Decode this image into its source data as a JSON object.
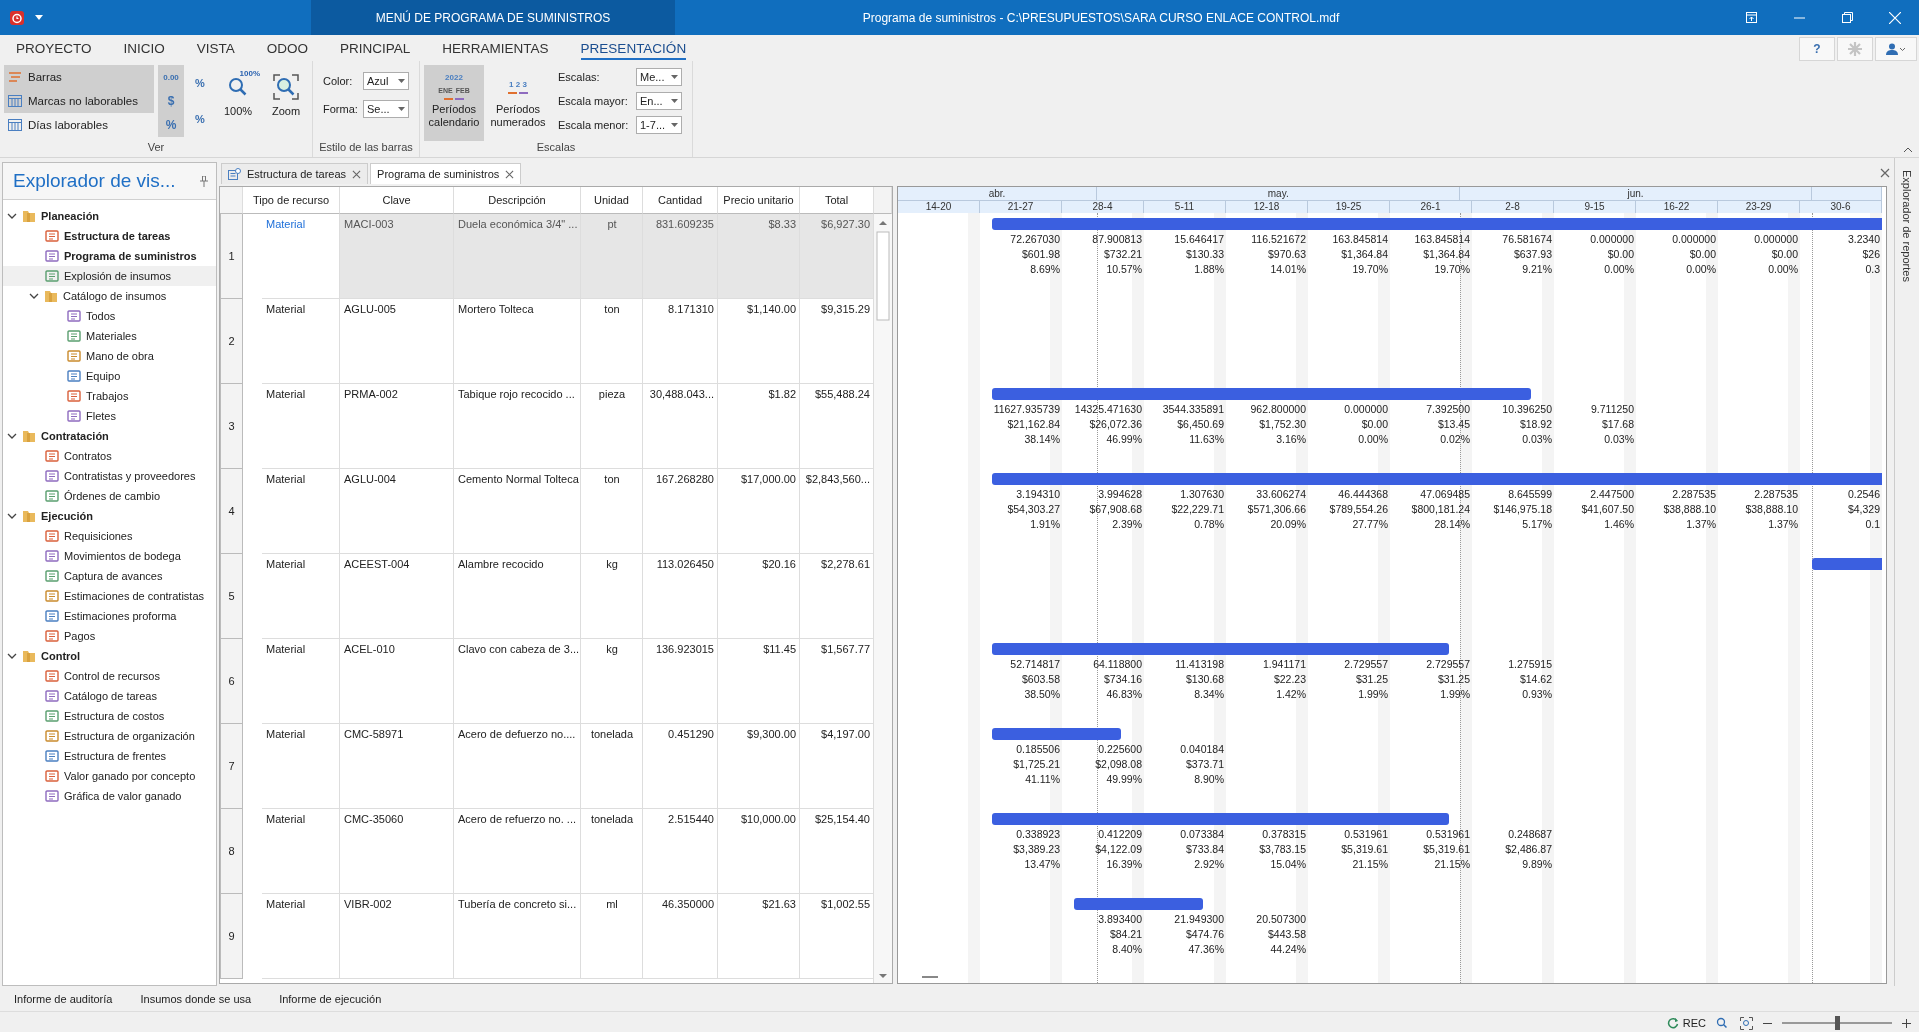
{
  "title_bar": {
    "context_title": "MENÚ DE PROGRAMA DE SUMINISTROS",
    "title": "Programa de suministros - C:\\PRESUPUESTOS\\SARA CURSO ENLACE CONTROL.mdf"
  },
  "ribbon": {
    "tabs": [
      {
        "label": "PROYECTO",
        "selected": false
      },
      {
        "label": "INICIO",
        "selected": false
      },
      {
        "label": "VISTA",
        "selected": false
      },
      {
        "label": "ODOO",
        "selected": false
      },
      {
        "label": "PRINCIPAL",
        "selected": false
      },
      {
        "label": "HERRAMIENTAS",
        "selected": false
      },
      {
        "label": "PRESENTACIÓN",
        "selected": true
      }
    ],
    "help_button": "?",
    "ver": {
      "title": "Ver",
      "toggles": [
        {
          "label": "Barras",
          "checked": true
        },
        {
          "label": "Marcas no laborables",
          "checked": true
        },
        {
          "label": "Días laborables",
          "checked": false
        }
      ],
      "format_buttons": [
        {
          "label": "0.00",
          "checked": true
        },
        {
          "label": "$",
          "checked": true
        },
        {
          "label": "%",
          "checked": true
        }
      ],
      "percent_buttons": [
        "%",
        "%"
      ],
      "zoom_buttons": [
        {
          "label": "100%",
          "icon_text": "100%"
        },
        {
          "label": "Zoom"
        }
      ]
    },
    "bar_style": {
      "title": "Estilo de las barras",
      "fields": [
        {
          "label": "Color:",
          "value": "Azul"
        },
        {
          "label": "Forma:",
          "value": "Se..."
        }
      ]
    },
    "scales": {
      "title": "Escalas",
      "period_buttons": [
        {
          "label": "Períodos calendario",
          "selected": true,
          "icon_text": [
            "2022",
            "ENE",
            "FEB"
          ]
        },
        {
          "label": "Períodos numerados",
          "selected": false,
          "icon_text": [
            "1 2 3"
          ]
        }
      ],
      "fields": [
        {
          "label": "Escalas:",
          "value": "Me..."
        },
        {
          "label": "Escala mayor:",
          "value": "En..."
        },
        {
          "label": "Escala menor:",
          "value": "1-7..."
        }
      ]
    }
  },
  "explorer": {
    "title": "Explorador de vis...",
    "groups": [
      {
        "label": "Planeación",
        "expanded": true,
        "children": [
          {
            "label": "Estructura de tareas",
            "open": true,
            "selected": false
          },
          {
            "label": "Programa de suministros",
            "open": true,
            "selected": false
          },
          {
            "label": "Explosión de insumos",
            "open": false,
            "selected": true
          },
          {
            "label": "Catálogo de insumos",
            "expanded": true,
            "children": [
              {
                "label": "Todos",
                "open": false,
                "selected": false
              },
              {
                "label": "Materiales",
                "open": false,
                "selected": false
              },
              {
                "label": "Mano de obra",
                "open": false,
                "selected": false
              },
              {
                "label": "Equipo",
                "open": false,
                "selected": false
              },
              {
                "label": "Trabajos",
                "open": false,
                "selected": false
              },
              {
                "label": "Fletes",
                "open": false,
                "selected": false
              }
            ]
          }
        ]
      },
      {
        "label": "Contratación",
        "expanded": true,
        "children": [
          {
            "label": "Contratos",
            "open": false,
            "selected": false
          },
          {
            "label": "Contratistas y proveedores",
            "open": false,
            "selected": false
          },
          {
            "label": "Órdenes de cambio",
            "open": false,
            "selected": false
          }
        ]
      },
      {
        "label": "Ejecución",
        "expanded": true,
        "children": [
          {
            "label": "Requisiciones",
            "open": false,
            "selected": false
          },
          {
            "label": "Movimientos de bodega",
            "open": false,
            "selected": false
          },
          {
            "label": "Captura de avances",
            "open": false,
            "selected": false
          },
          {
            "label": "Estimaciones de contratistas",
            "open": false,
            "selected": false
          },
          {
            "label": "Estimaciones proforma",
            "open": false,
            "selected": false
          },
          {
            "label": "Pagos",
            "open": false,
            "selected": false
          }
        ]
      },
      {
        "label": "Control",
        "expanded": true,
        "children": [
          {
            "label": "Control de recursos",
            "open": false,
            "selected": false
          },
          {
            "label": "Catálogo de tareas",
            "open": false,
            "selected": false
          },
          {
            "label": "Estructura de costos",
            "open": false,
            "selected": false
          },
          {
            "label": "Estructura de organización",
            "open": false,
            "selected": false
          },
          {
            "label": "Estructura de frentes",
            "open": false,
            "selected": false
          },
          {
            "label": "Valor ganado por concepto",
            "open": false,
            "selected": false
          },
          {
            "label": "Gráfica de valor ganado",
            "open": false,
            "selected": false
          }
        ]
      }
    ]
  },
  "document_tabs": [
    {
      "label": "Estructura de tareas",
      "selected": false
    },
    {
      "label": "Programa de suministros",
      "selected": true
    }
  ],
  "table": {
    "columns": [
      "Tipo de recurso",
      "Clave",
      "Descripción",
      "Unidad",
      "Cantidad",
      "Precio unitario",
      "Total"
    ],
    "rows": [
      {
        "number": "1",
        "selected": true,
        "cells": [
          "Material",
          "MACI-003",
          "Duela económica 3/4\" ...",
          "pt",
          "831.609235",
          "$8.33",
          "$6,927.30"
        ],
        "timeline": [
          {
            "bar": false
          },
          {
            "bar": true,
            "quantity": "72.267030",
            "cost": "$601.98",
            "percent": "8.69%"
          },
          {
            "bar": true,
            "quantity": "87.900813",
            "cost": "$732.21",
            "percent": "10.57%"
          },
          {
            "bar": true,
            "quantity": "15.646417",
            "cost": "$130.33",
            "percent": "1.88%"
          },
          {
            "bar": true,
            "quantity": "116.521672",
            "cost": "$970.63",
            "percent": "14.01%"
          },
          {
            "bar": true,
            "quantity": "163.845814",
            "cost": "$1,364.84",
            "percent": "19.70%"
          },
          {
            "bar": true,
            "quantity": "163.845814",
            "cost": "$1,364.84",
            "percent": "19.70%"
          },
          {
            "bar": true,
            "quantity": "76.581674",
            "cost": "$637.93",
            "percent": "9.21%"
          },
          {
            "bar": true,
            "quantity": "0.000000",
            "cost": "$0.00",
            "percent": "0.00%"
          },
          {
            "bar": true,
            "quantity": "0.000000",
            "cost": "$0.00",
            "percent": "0.00%"
          },
          {
            "bar": true,
            "quantity": "0.000000",
            "cost": "$0.00",
            "percent": "0.00%"
          },
          {
            "bar": true,
            "quantity": "3.2340",
            "cost": "$26",
            "percent": "0.3"
          }
        ]
      },
      {
        "number": "2",
        "selected": false,
        "cells": [
          "Material",
          "AGLU-005",
          "Mortero Tolteca",
          "ton",
          "8.171310",
          "$1,140.00",
          "$9,315.29"
        ],
        "timeline": [
          {
            "bar": false
          },
          {
            "bar": false
          },
          {
            "bar": false
          },
          {
            "bar": false
          },
          {
            "bar": false
          },
          {
            "bar": false
          },
          {
            "bar": false
          },
          {
            "bar": false
          },
          {
            "bar": false
          },
          {
            "bar": false
          },
          {
            "bar": false
          },
          {
            "bar": false
          }
        ]
      },
      {
        "number": "3",
        "selected": false,
        "cells": [
          "Material",
          "PRMA-002",
          "Tabique rojo recocido ...",
          "pieza",
          "30,488.043...",
          "$1.82",
          "$55,488.24"
        ],
        "timeline": [
          {
            "bar": false
          },
          {
            "bar": true,
            "quantity": "11627.935739",
            "cost": "$21,162.84",
            "percent": "38.14%"
          },
          {
            "bar": true,
            "quantity": "14325.471630",
            "cost": "$26,072.36",
            "percent": "46.99%"
          },
          {
            "bar": true,
            "quantity": "3544.335891",
            "cost": "$6,450.69",
            "percent": "11.63%"
          },
          {
            "bar": true,
            "quantity": "962.800000",
            "cost": "$1,752.30",
            "percent": "3.16%"
          },
          {
            "bar": true,
            "quantity": "0.000000",
            "cost": "$0.00",
            "percent": "0.00%"
          },
          {
            "bar": true,
            "quantity": "7.392500",
            "cost": "$13.45",
            "percent": "0.02%"
          },
          {
            "bar": true,
            "quantity": "10.396250",
            "cost": "$18.92",
            "percent": "0.03%"
          },
          {
            "bar": false,
            "quantity": "9.711250",
            "cost": "$17.68",
            "percent": "0.03%"
          },
          {
            "bar": false
          },
          {
            "bar": false
          },
          {
            "bar": false
          }
        ]
      },
      {
        "number": "4",
        "selected": false,
        "cells": [
          "Material",
          "AGLU-004",
          "Cemento Normal Tolteca",
          "ton",
          "167.268280",
          "$17,000.00",
          "$2,843,560..."
        ],
        "timeline": [
          {
            "bar": false
          },
          {
            "bar": true,
            "quantity": "3.194310",
            "cost": "$54,303.27",
            "percent": "1.91%"
          },
          {
            "bar": true,
            "quantity": "3.994628",
            "cost": "$67,908.68",
            "percent": "2.39%"
          },
          {
            "bar": true,
            "quantity": "1.307630",
            "cost": "$22,229.71",
            "percent": "0.78%"
          },
          {
            "bar": true,
            "quantity": "33.606274",
            "cost": "$571,306.66",
            "percent": "20.09%"
          },
          {
            "bar": true,
            "quantity": "46.444368",
            "cost": "$789,554.26",
            "percent": "27.77%"
          },
          {
            "bar": true,
            "quantity": "47.069485",
            "cost": "$800,181.24",
            "percent": "28.14%"
          },
          {
            "bar": true,
            "quantity": "8.645599",
            "cost": "$146,975.18",
            "percent": "5.17%"
          },
          {
            "bar": true,
            "quantity": "2.447500",
            "cost": "$41,607.50",
            "percent": "1.46%"
          },
          {
            "bar": true,
            "quantity": "2.287535",
            "cost": "$38,888.10",
            "percent": "1.37%"
          },
          {
            "bar": true,
            "quantity": "2.287535",
            "cost": "$38,888.10",
            "percent": "1.37%"
          },
          {
            "bar": true,
            "quantity": "0.2546",
            "cost": "$4,329",
            "percent": "0.1"
          }
        ]
      },
      {
        "number": "5",
        "selected": false,
        "cells": [
          "Material",
          "ACEEST-004",
          "Alambre recocido",
          "kg",
          "113.026450",
          "$20.16",
          "$2,278.61"
        ],
        "timeline": [
          {
            "bar": false
          },
          {
            "bar": false
          },
          {
            "bar": false
          },
          {
            "bar": false
          },
          {
            "bar": false
          },
          {
            "bar": false
          },
          {
            "bar": false
          },
          {
            "bar": false
          },
          {
            "bar": false
          },
          {
            "bar": false
          },
          {
            "bar": false
          },
          {
            "bar": true
          }
        ]
      },
      {
        "number": "6",
        "selected": false,
        "cells": [
          "Material",
          "ACEL-010",
          "Clavo con cabeza de 3...",
          "kg",
          "136.923015",
          "$11.45",
          "$1,567.77"
        ],
        "timeline": [
          {
            "bar": false
          },
          {
            "bar": true,
            "quantity": "52.714817",
            "cost": "$603.58",
            "percent": "38.50%"
          },
          {
            "bar": true,
            "quantity": "64.118800",
            "cost": "$734.16",
            "percent": "46.83%"
          },
          {
            "bar": true,
            "quantity": "11.413198",
            "cost": "$130.68",
            "percent": "8.34%"
          },
          {
            "bar": true,
            "quantity": "1.941171",
            "cost": "$22.23",
            "percent": "1.42%"
          },
          {
            "bar": true,
            "quantity": "2.729557",
            "cost": "$31.25",
            "percent": "1.99%"
          },
          {
            "bar": true,
            "quantity": "2.729557",
            "cost": "$31.25",
            "percent": "1.99%"
          },
          {
            "bar": false,
            "quantity": "1.275915",
            "cost": "$14.62",
            "percent": "0.93%"
          },
          {
            "bar": false
          },
          {
            "bar": false
          },
          {
            "bar": false
          },
          {
            "bar": false
          }
        ]
      },
      {
        "number": "7",
        "selected": false,
        "cells": [
          "Material",
          "CMC-58971",
          "Acero de defuerzo no....",
          "tonelada",
          "0.451290",
          "$9,300.00",
          "$4,197.00"
        ],
        "timeline": [
          {
            "bar": false
          },
          {
            "bar": true,
            "quantity": "0.185506",
            "cost": "$1,725.21",
            "percent": "41.11%"
          },
          {
            "bar": true,
            "quantity": "0.225600",
            "cost": "$2,098.08",
            "percent": "49.99%"
          },
          {
            "bar": false,
            "quantity": "0.040184",
            "cost": "$373.71",
            "percent": "8.90%"
          },
          {
            "bar": false
          },
          {
            "bar": false
          },
          {
            "bar": false
          },
          {
            "bar": false
          },
          {
            "bar": false
          },
          {
            "bar": false
          },
          {
            "bar": false
          },
          {
            "bar": false
          }
        ]
      },
      {
        "number": "8",
        "selected": false,
        "cells": [
          "Material",
          "CMC-35060",
          "Acero de refuerzo no. ...",
          "tonelada",
          "2.515440",
          "$10,000.00",
          "$25,154.40"
        ],
        "timeline": [
          {
            "bar": false
          },
          {
            "bar": true,
            "quantity": "0.338923",
            "cost": "$3,389.23",
            "percent": "13.47%"
          },
          {
            "bar": true,
            "quantity": "0.412209",
            "cost": "$4,122.09",
            "percent": "16.39%"
          },
          {
            "bar": true,
            "quantity": "0.073384",
            "cost": "$733.84",
            "percent": "2.92%"
          },
          {
            "bar": true,
            "quantity": "0.378315",
            "cost": "$3,783.15",
            "percent": "15.04%"
          },
          {
            "bar": true,
            "quantity": "0.531961",
            "cost": "$5,319.61",
            "percent": "21.15%"
          },
          {
            "bar": true,
            "quantity": "0.531961",
            "cost": "$5,319.61",
            "percent": "21.15%"
          },
          {
            "bar": false,
            "quantity": "0.248687",
            "cost": "$2,486.87",
            "percent": "9.89%"
          },
          {
            "bar": false
          },
          {
            "bar": false
          },
          {
            "bar": false
          },
          {
            "bar": false
          }
        ]
      },
      {
        "number": "9",
        "selected": false,
        "cells": [
          "Material",
          "VIBR-002",
          "Tubería de concreto si...",
          "ml",
          "46.350000",
          "$21.63",
          "$1,002.55"
        ],
        "timeline": [
          {
            "bar": false
          },
          {
            "bar": false
          },
          {
            "bar": true,
            "quantity": "3.893400",
            "cost": "$84.21",
            "percent": "8.40%"
          },
          {
            "bar": true,
            "quantity": "21.949300",
            "cost": "$474.76",
            "percent": "47.36%"
          },
          {
            "bar": false,
            "quantity": "20.507300",
            "cost": "$443.58",
            "percent": "44.24%"
          },
          {
            "bar": false
          },
          {
            "bar": false
          },
          {
            "bar": false
          },
          {
            "bar": false
          },
          {
            "bar": false
          },
          {
            "bar": false
          },
          {
            "bar": false
          }
        ]
      }
    ]
  },
  "gantt": {
    "months": [
      "abr.",
      "may.",
      "jun."
    ],
    "weeks": [
      "14-20",
      "21-27",
      "28-4",
      "5-11",
      "12-18",
      "19-25",
      "26-1",
      "2-8",
      "9-15",
      "16-22",
      "23-29",
      "30-6"
    ]
  },
  "side_panel": {
    "title": "Explorador de reportes"
  },
  "bottom_tabs": [
    "Informe de auditoría",
    "Insumos donde se usa",
    "Informe de ejecución"
  ],
  "status_bar": {
    "rec": "REC",
    "zoom": {
      "level": 0.5
    }
  }
}
